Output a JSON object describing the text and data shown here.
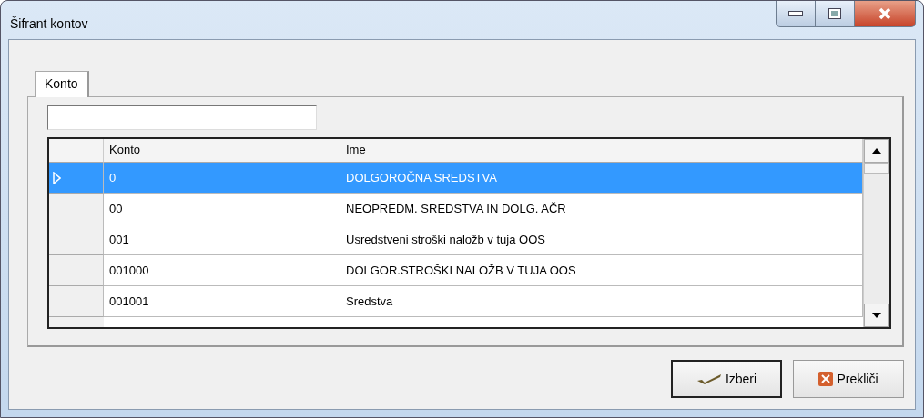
{
  "window": {
    "title": "Šifrant kontov"
  },
  "tabs": [
    {
      "label": "Konto",
      "selected": true
    }
  ],
  "table": {
    "columns": [
      "Konto",
      "Ime"
    ],
    "rows": [
      {
        "konto": "0",
        "ime": "DOLGOROČNA SREDSTVA",
        "selected": true
      },
      {
        "konto": "00",
        "ime": "NEOPREDM. SREDSTVA IN DOLG. AČR",
        "selected": false
      },
      {
        "konto": "001",
        "ime": "Usredstveni stroški naložb v tuja OOS",
        "selected": false
      },
      {
        "konto": "001000",
        "ime": "DOLGOR.STROŠKI NALOŽB V TUJA OOS",
        "selected": false
      },
      {
        "konto": "001001",
        "ime": "Sredstva",
        "selected": false
      }
    ]
  },
  "buttons": [
    {
      "label": "Izberi",
      "kind": "ok"
    },
    {
      "label": "Prekliči",
      "kind": "cancel"
    }
  ]
}
